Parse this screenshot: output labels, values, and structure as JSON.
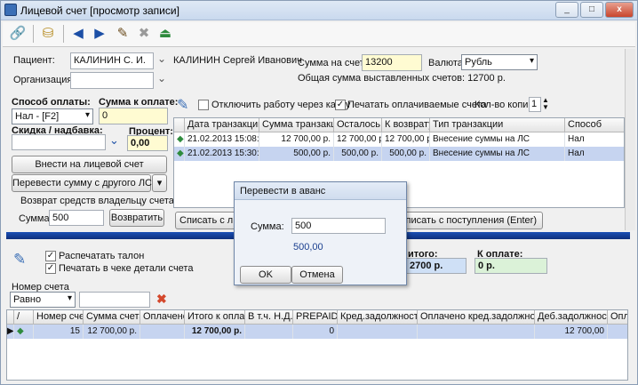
{
  "window": {
    "title": "Лицевой счет [просмотр записи]",
    "controls": [
      "_",
      "□",
      "x"
    ]
  },
  "patient": {
    "label": "Пациент:",
    "short_name": "КАЛИНИН С. И.",
    "full_name": "КАЛИНИН Сергей Иванович",
    "org_label": "Организация:",
    "org_value": ""
  },
  "account": {
    "sum_label": "Сумма на счете:",
    "sum_value": "13200",
    "currency_label": "Валюта:",
    "currency_value": "Рубль",
    "total_text": "Общая сумма выставленных счетов: 12700 р."
  },
  "payment": {
    "method_label": "Способ оплаты:",
    "method_value": "Нал - [F2]",
    "sum_label": "Сумма к оплате:",
    "sum_value": "0",
    "discount_label": "Скидка / надбавка:",
    "discount_value": "",
    "percent_label": "Процент:",
    "percent_value": "0,00",
    "deposit_button": "Внести на лицевой счет",
    "transfer_button": "Перевести сумму с другого ЛС",
    "refund_label": "Возврат средств владельцу счета",
    "refund_sum_label": "Сумма:",
    "refund_sum_value": "500",
    "refund_button": "Возвратить"
  },
  "options": {
    "no_cash_register": "Отключить работу через кассу",
    "no_cash_register_checked": false,
    "print_paid": "Печатать оплачиваемые счета",
    "print_paid_checked": true,
    "copies_label": "Кол-во копий:",
    "copies_value": "1"
  },
  "transactions": {
    "columns": [
      "Дата транзакции",
      "Сумма транзакции",
      "Осталось",
      "К возврату",
      "Тип транзакции",
      "Способ"
    ],
    "rows": [
      {
        "date": "21.02.2013 15:08:35",
        "sum": "12 700,00 р.",
        "left": "12 700,00 р.",
        "refund": "12 700,00 р.",
        "type": "Внесение суммы на ЛС",
        "method": "Нал"
      },
      {
        "date": "21.02.2013 15:30:01",
        "sum": "500,00 р.",
        "left": "500,00 р.",
        "refund": "500,00 р.",
        "type": "Внесение суммы на ЛС",
        "method": "Нал"
      }
    ],
    "write_off_button": "Списать с л",
    "write_off_income_button": "Списать с поступления (Enter)"
  },
  "coupon": {
    "print_coupon": "Распечатать талон",
    "print_coupon_checked": true,
    "print_details": "Печатать в чеке детали счета",
    "print_details_checked": true,
    "total_label": "итого:",
    "total_value": "2700 р.",
    "to_pay_label": "К оплате:",
    "to_pay_value": "0 р."
  },
  "filter": {
    "label": "Номер счета",
    "operator": "Равно",
    "value": ""
  },
  "invoices": {
    "columns": [
      "/",
      "Номер счета",
      "Сумма счета",
      "Оплачено",
      "Итого к оплате",
      "В т.ч. Н.Д.С.",
      "PREPAID",
      "Кред.задолжность",
      "Оплачено кред.задолжности",
      "Деб.задолжность",
      "Оплач"
    ],
    "rows": [
      {
        "number": "15",
        "sum": "12 700,00 р.",
        "paid": "",
        "total": "12 700,00 р.",
        "vat": "",
        "prepaid": "0",
        "credit": "",
        "credit_paid": "",
        "debit": "12 700,00"
      }
    ]
  },
  "dialog": {
    "title": "Перевести в аванс",
    "sum_label": "Сумма:",
    "sum_value": "500",
    "sum_display": "500,00",
    "ok": "OK",
    "cancel": "Отмена"
  }
}
